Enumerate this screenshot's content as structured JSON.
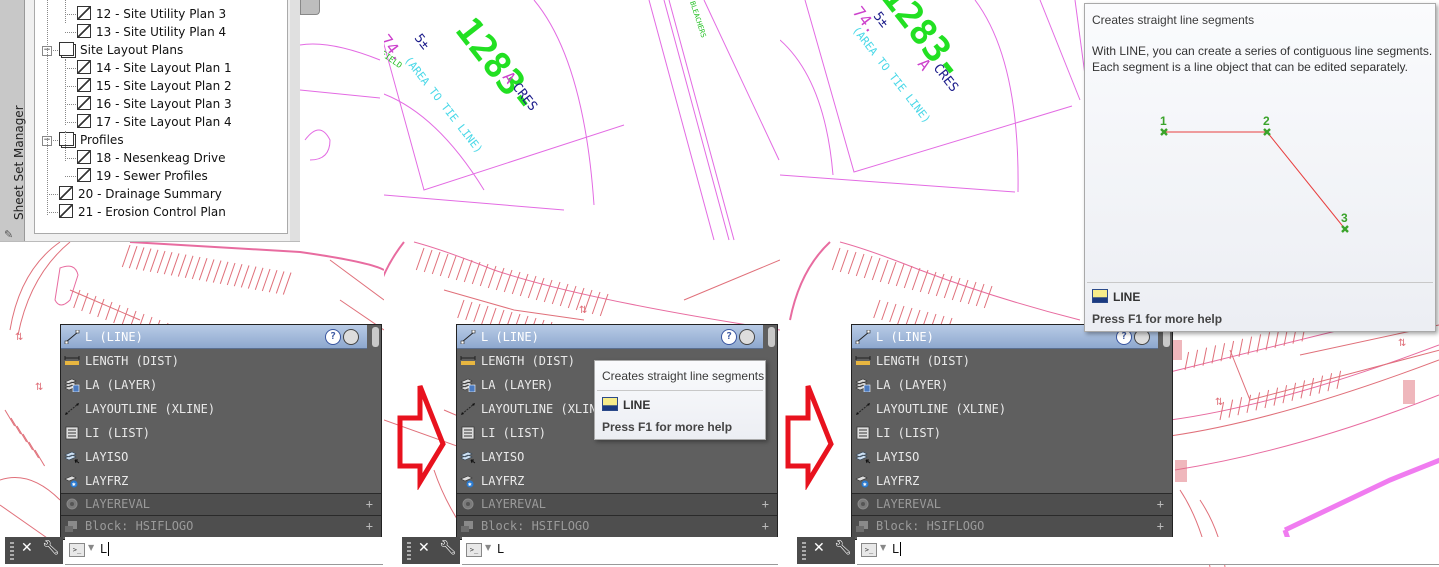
{
  "sheet_set_manager": {
    "tab_label": "Sheet Set Manager",
    "tree": [
      {
        "label": "12 - Site Utility Plan 3",
        "type": "sheet",
        "level": 2
      },
      {
        "label": "13 - Site Utility Plan 4",
        "type": "sheet",
        "level": 2
      },
      {
        "label": "Site Layout Plans",
        "type": "subset",
        "level": 1
      },
      {
        "label": "14 - Site Layout Plan 1",
        "type": "sheet",
        "level": 2
      },
      {
        "label": "15 - Site Layout Plan 2",
        "type": "sheet",
        "level": 2
      },
      {
        "label": "16 - Site Layout Plan 3",
        "type": "sheet",
        "level": 2
      },
      {
        "label": "17 - Site Layout Plan 4",
        "type": "sheet",
        "level": 2
      },
      {
        "label": "Profiles",
        "type": "subset",
        "level": 1
      },
      {
        "label": "18 - Nesenkeag Drive",
        "type": "sheet",
        "level": 2
      },
      {
        "label": "19 - Sewer Profiles",
        "type": "sheet",
        "level": 2
      },
      {
        "label": "20 - Drainage Summary",
        "type": "sheet",
        "level": 1
      },
      {
        "label": "21 - Erosion Control Plan",
        "type": "sheet",
        "level": 1
      }
    ]
  },
  "drawing": {
    "lot_number": "1283-",
    "area_value": "74.5±",
    "area_unit": "ACRES",
    "area_note": "(AREA TO TIE LINE)",
    "field_label": "PROPOSED BASEBALL FIELD",
    "bleachers_label": "BLEACHERS",
    "colors": {
      "linework": "#e36be3",
      "parking": "#e0707a",
      "text_green": "#22e022",
      "text_cyan": "#4ad8e8",
      "text_navy": "#1a1a8a"
    }
  },
  "autocomplete": {
    "items": [
      {
        "label": "L (LINE)",
        "icon": "line-icon",
        "selected": true
      },
      {
        "label": "LENGTH (DIST)",
        "icon": "measure-icon"
      },
      {
        "label": "LA (LAYER)",
        "icon": "layer-icon"
      },
      {
        "label": "LAYOUTLINE (XLINE)",
        "icon": "xline-icon"
      },
      {
        "label": "LI (LIST)",
        "icon": "list-icon"
      },
      {
        "label": "LAYISO",
        "icon": "layiso-icon"
      },
      {
        "label": "LAYFRZ",
        "icon": "layfrz-icon"
      }
    ],
    "categories": [
      {
        "label": "LAYEREVAL",
        "icon": "gear-icon"
      },
      {
        "label": "Block: HSIFLOGO",
        "icon": "block-icon"
      }
    ],
    "help_icon": "?"
  },
  "command_line": {
    "value": "L",
    "close_icon": "✕",
    "settings_icon": "wrench"
  },
  "tooltip_small": {
    "title": "Creates straight line segments",
    "command": "LINE",
    "help": "Press F1 for more help"
  },
  "tooltip_large": {
    "title": "Creates straight line segments",
    "description_line1": "With LINE, you can create a series of contiguous line segments.",
    "description_line2": "Each segment is a line object that can be edited separately.",
    "points": [
      "1",
      "2",
      "3"
    ],
    "command": "LINE",
    "help": "Press F1 for more help"
  },
  "annotation": {
    "arrow_color": "#e8121e"
  }
}
